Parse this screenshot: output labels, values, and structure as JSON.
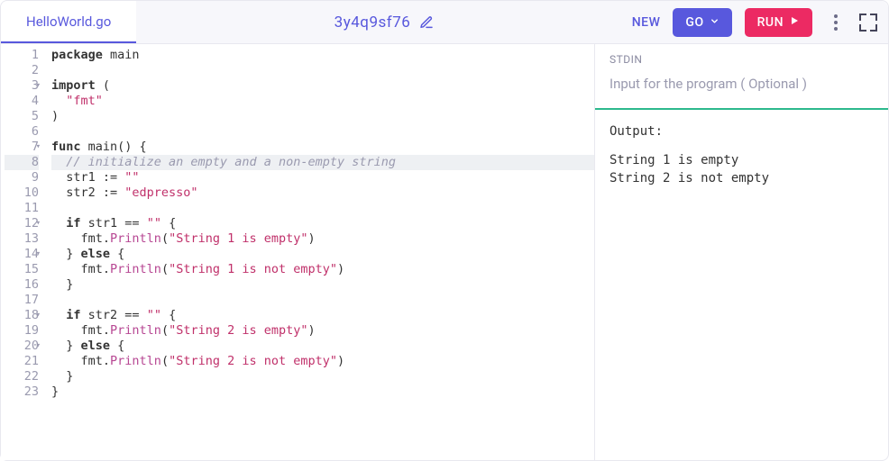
{
  "tab": {
    "filename": "HelloWorld.go"
  },
  "share": {
    "id": "3y4q9sf76"
  },
  "toolbar": {
    "new_label": "NEW",
    "lang_label": "GO",
    "run_label": "RUN"
  },
  "editor": {
    "lines": [
      "package main",
      "",
      "import (",
      "  \"fmt\"",
      ")",
      "",
      "func main() {",
      "  // initialize an empty and a non-empty string",
      "  str1 := \"\"",
      "  str2 := \"edpresso\"",
      "",
      "  if str1 == \"\" {",
      "    fmt.Println(\"String 1 is empty\")",
      "  } else {",
      "    fmt.Println(\"String 1 is not empty\")",
      "  }",
      "",
      "  if str2 == \"\" {",
      "    fmt.Println(\"String 2 is empty\")",
      "  } else {",
      "    fmt.Println(\"String 2 is not empty\")",
      "  }",
      "}"
    ],
    "fold_lines": [
      3,
      7,
      12,
      14,
      18,
      20
    ],
    "highlight_line": 8
  },
  "stdin": {
    "label": "STDIN",
    "placeholder": "Input for the program ( Optional )",
    "value": ""
  },
  "output": {
    "label": "Output:",
    "text": "String 1 is empty\nString 2 is not empty"
  }
}
